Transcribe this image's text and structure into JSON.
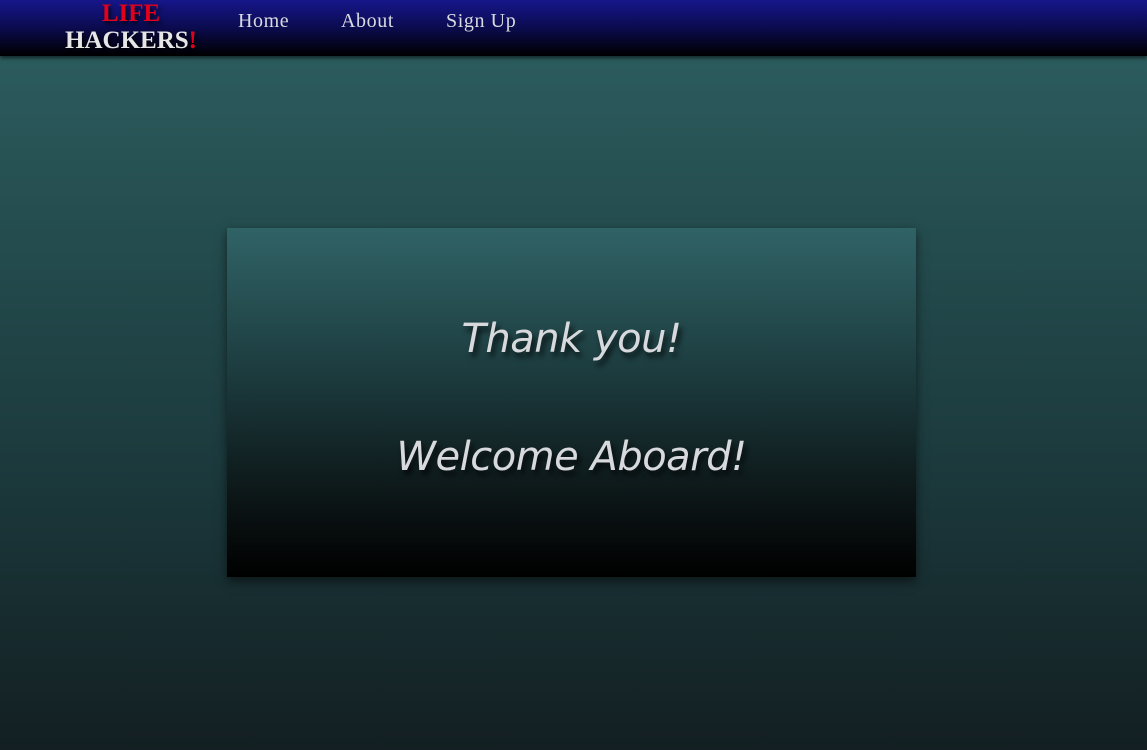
{
  "brand": {
    "line1": "LIFE",
    "line2": "HACKERS",
    "exclaim": "!",
    "accent_color": "#e3001b"
  },
  "nav": {
    "items": [
      {
        "label": "Home"
      },
      {
        "label": "About"
      },
      {
        "label": "Sign Up"
      }
    ]
  },
  "main": {
    "heading": "Thank you!",
    "subheading": "Welcome Aboard!"
  }
}
